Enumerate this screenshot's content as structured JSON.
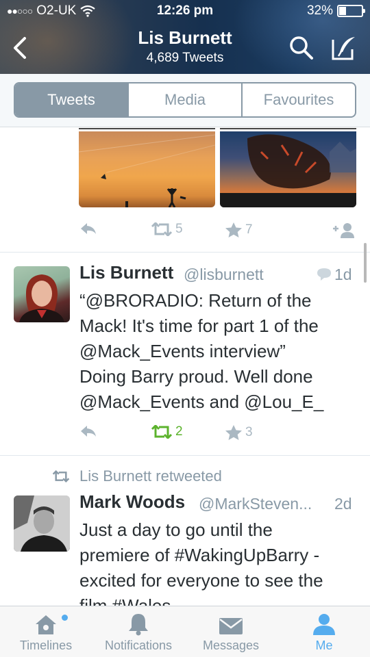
{
  "status_bar": {
    "signal": "●●○○○",
    "carrier": "O2-UK",
    "time": "12:26 pm",
    "battery": "32%"
  },
  "header": {
    "title": "Lis Burnett",
    "subtitle": "4,689 Tweets"
  },
  "segments": [
    {
      "label": "Tweets",
      "active": true
    },
    {
      "label": "Media",
      "active": false
    },
    {
      "label": "Favourites",
      "active": false
    }
  ],
  "tweet0": {
    "retweets": "5",
    "favourites": "7"
  },
  "tweet1": {
    "name": "Lis Burnett",
    "handle": "@lisburnett",
    "time": "1d",
    "text_lines": [
      "“@BRORADIO: Return of the",
      "Mack! It's time for part 1 of the",
      "@Mack_Events interview”",
      "Doing Barry proud. Well done",
      "@Mack_Events and @Lou_E_"
    ],
    "retweets": "2",
    "favourites": "3"
  },
  "tweet2": {
    "retweeted_by": "Lis Burnett retweeted",
    "name": "Mark Woods",
    "handle": "@MarkSteven...",
    "time": "2d",
    "text_lines": [
      "Just a day to go until the",
      "premiere of  #WakingUpBarry -",
      "excited for everyone to see the",
      "film #Wales"
    ]
  },
  "tabbar": [
    {
      "label": "Timelines",
      "active": false
    },
    {
      "label": "Notifications",
      "active": false
    },
    {
      "label": "Messages",
      "active": false
    },
    {
      "label": "Me",
      "active": true
    }
  ],
  "colors": {
    "accent": "#55acee",
    "retweet_active": "#5cb32d",
    "muted": "#8899a6"
  }
}
